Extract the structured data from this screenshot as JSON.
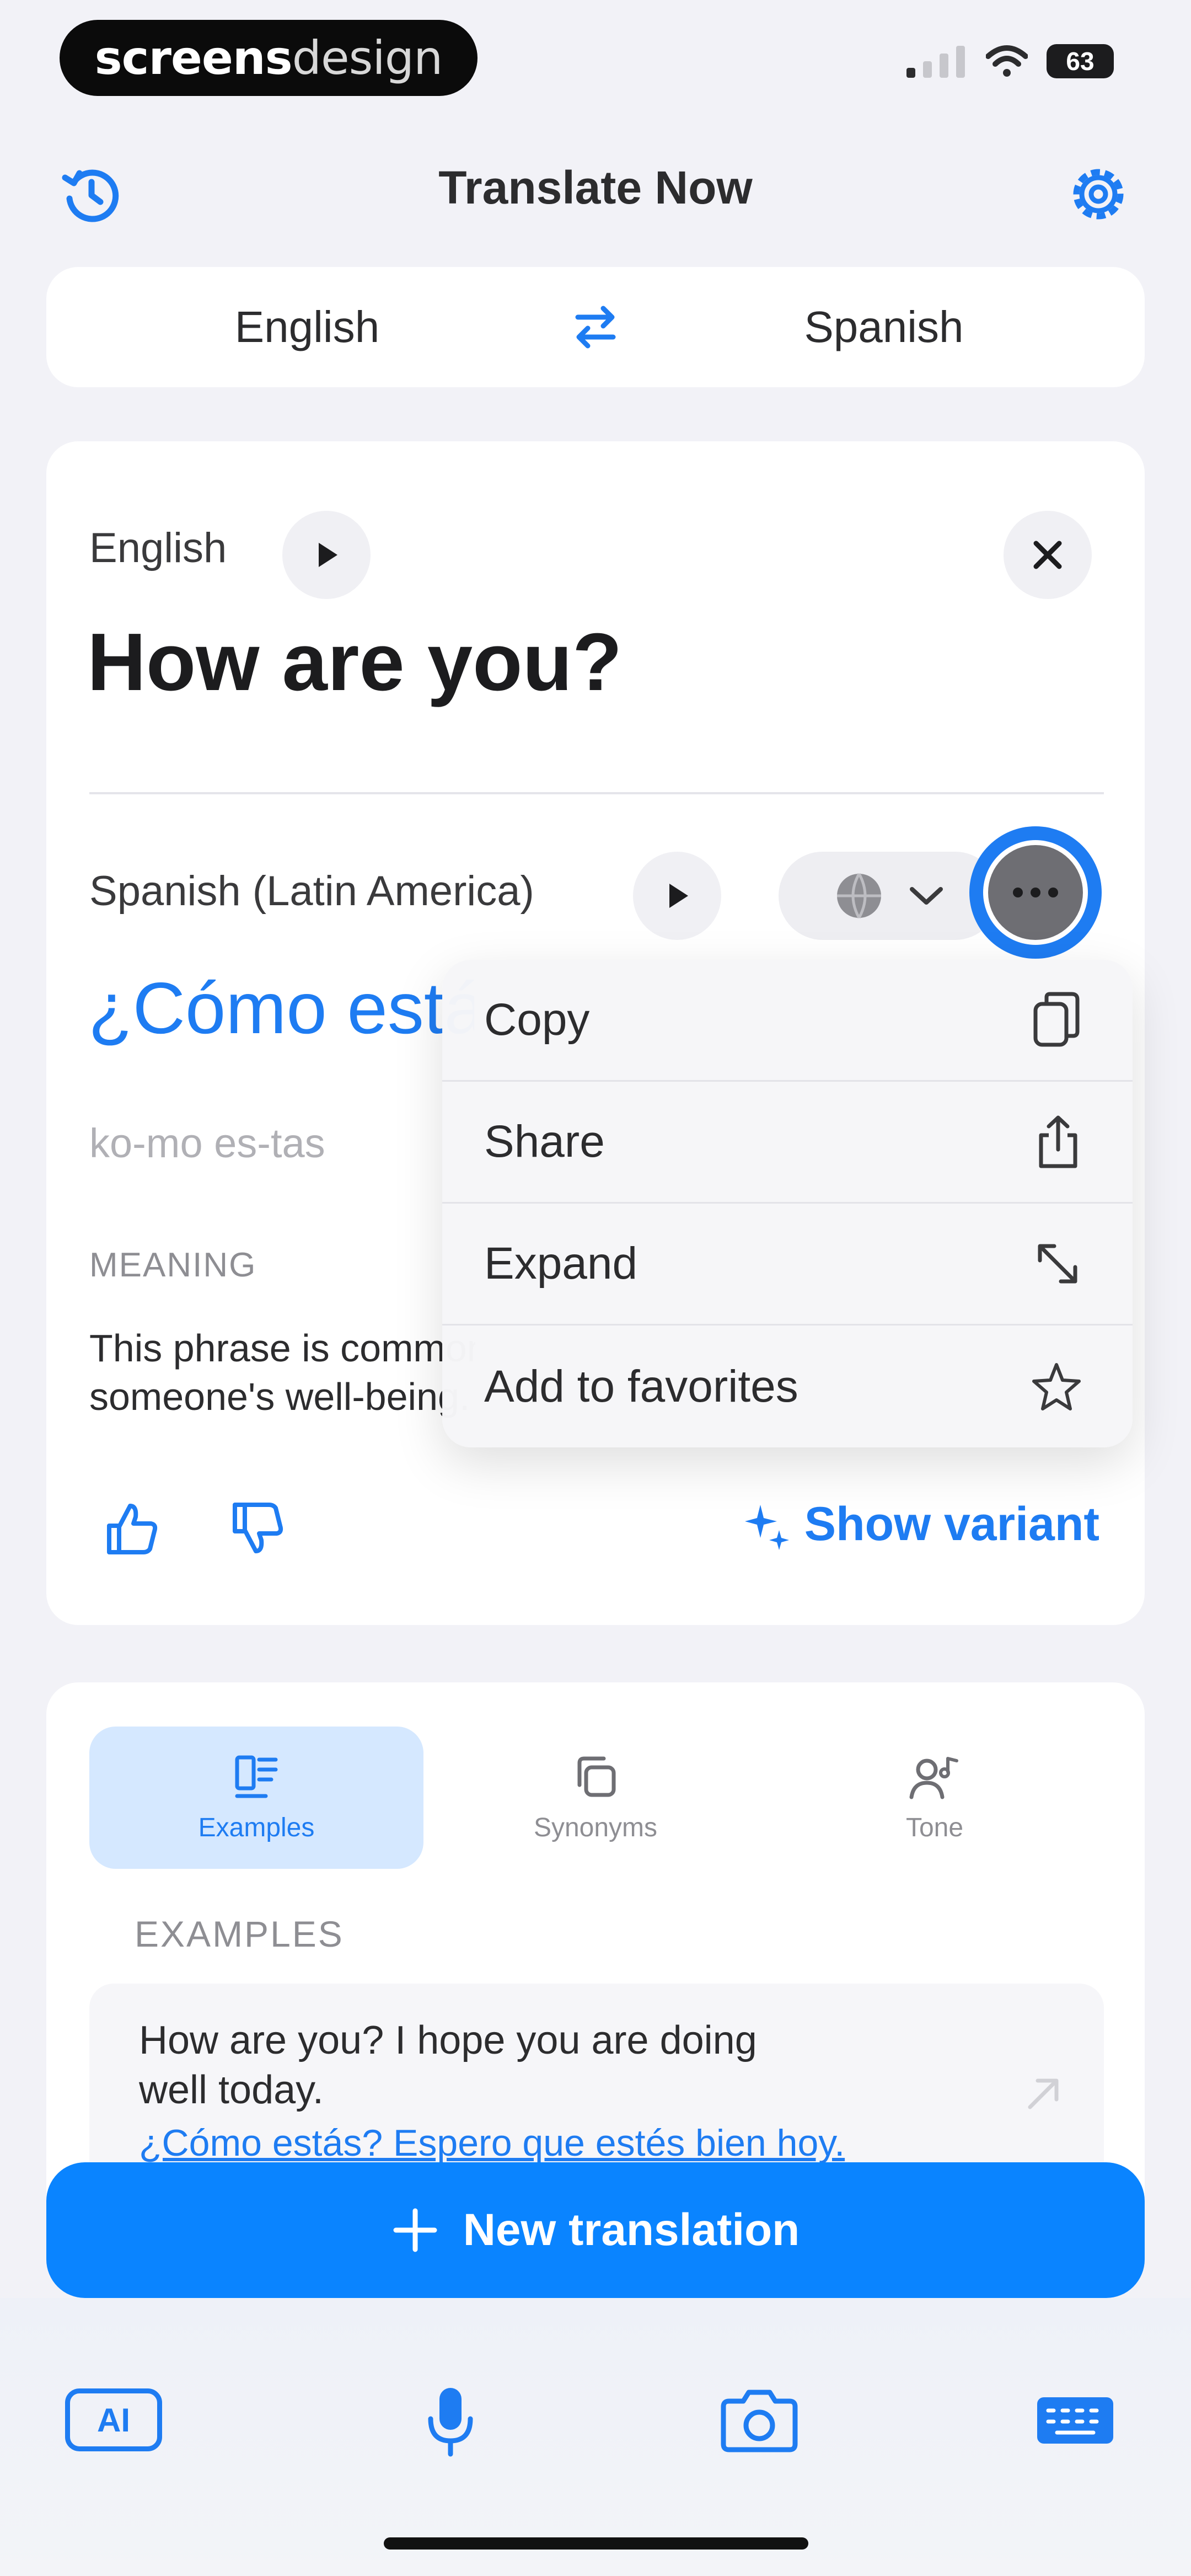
{
  "status_bar": {
    "brand_bold": "screens",
    "brand_light": "design",
    "battery": "63"
  },
  "header": {
    "title": "Translate Now"
  },
  "languages": {
    "source": "English",
    "target": "Spanish"
  },
  "source": {
    "language": "English",
    "text": "How are you?"
  },
  "target": {
    "language": "Spanish (Latin America)",
    "text": "¿Cómo estás?",
    "phonetic": "ko-mo es-tas",
    "meaning_label": "MEANING",
    "meaning_line1": "This phrase is commonly used to ask about",
    "meaning_line2": "someone's well-being."
  },
  "feedback": {
    "variant_label": "Show variant"
  },
  "context_menu": {
    "items": [
      {
        "label": "Copy",
        "icon": "copy-icon"
      },
      {
        "label": "Share",
        "icon": "share-icon"
      },
      {
        "label": "Expand",
        "icon": "expand-icon"
      },
      {
        "label": "Add to favorites",
        "icon": "star-icon"
      }
    ]
  },
  "tabs": [
    {
      "label": "Examples",
      "icon": "examples-icon",
      "active": true
    },
    {
      "label": "Synonyms",
      "icon": "synonyms-icon",
      "active": false
    },
    {
      "label": "Tone",
      "icon": "tone-icon",
      "active": false
    }
  ],
  "examples": {
    "label": "EXAMPLES",
    "item": {
      "source_line1": "How are you? I hope you are doing",
      "source_line2": "well today.",
      "target": "¿Cómo estás? Espero que estés bien hoy."
    }
  },
  "actions": {
    "new_translation": "New translation"
  },
  "toolbar": {
    "ai_label": "AI"
  },
  "colors": {
    "accent": "#1e7cf2",
    "button": "#0a84ff",
    "background": "#f2f2f7",
    "active_tab": "#d5e8ff"
  }
}
